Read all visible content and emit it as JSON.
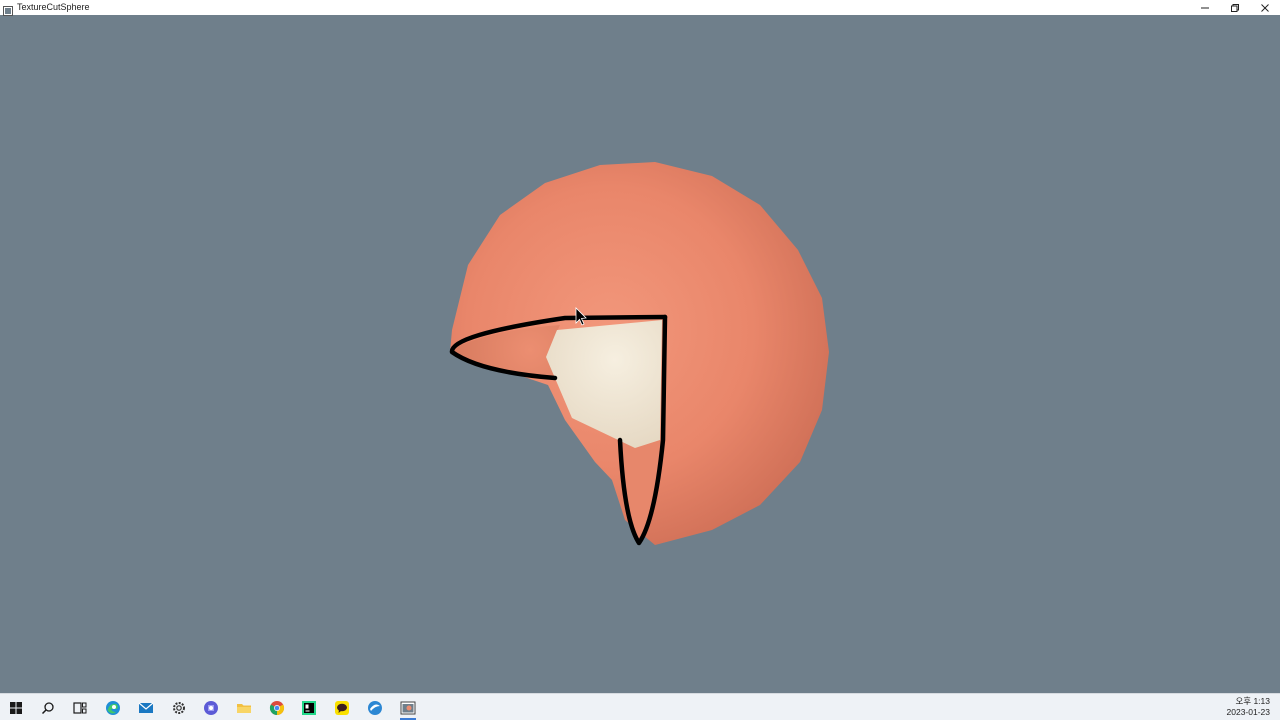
{
  "window": {
    "title": "TextureCutSphere",
    "background": "#6f7f8b"
  },
  "caption": {
    "minimize_icon": "minimize-icon",
    "restore_icon": "restore-icon",
    "close_icon": "close-icon"
  },
  "scene": {
    "sphere_color": "#ec8d70",
    "cap_color": "#efe6d6",
    "outline_color": "#000000"
  },
  "taskbar": {
    "items": [
      {
        "name": "start-icon"
      },
      {
        "name": "search-icon"
      },
      {
        "name": "task-view-icon"
      },
      {
        "name": "edge-browser-icon"
      },
      {
        "name": "mail-icon"
      },
      {
        "name": "settings-icon"
      },
      {
        "name": "copilot-icon"
      },
      {
        "name": "file-explorer-icon"
      },
      {
        "name": "chrome-icon"
      },
      {
        "name": "pycharm-icon"
      },
      {
        "name": "kakaotalk-icon"
      },
      {
        "name": "app-icon"
      },
      {
        "name": "texturecutsphere-app-icon"
      }
    ],
    "clock": {
      "time": "오후 1:13",
      "date": "2023-01-23"
    }
  }
}
